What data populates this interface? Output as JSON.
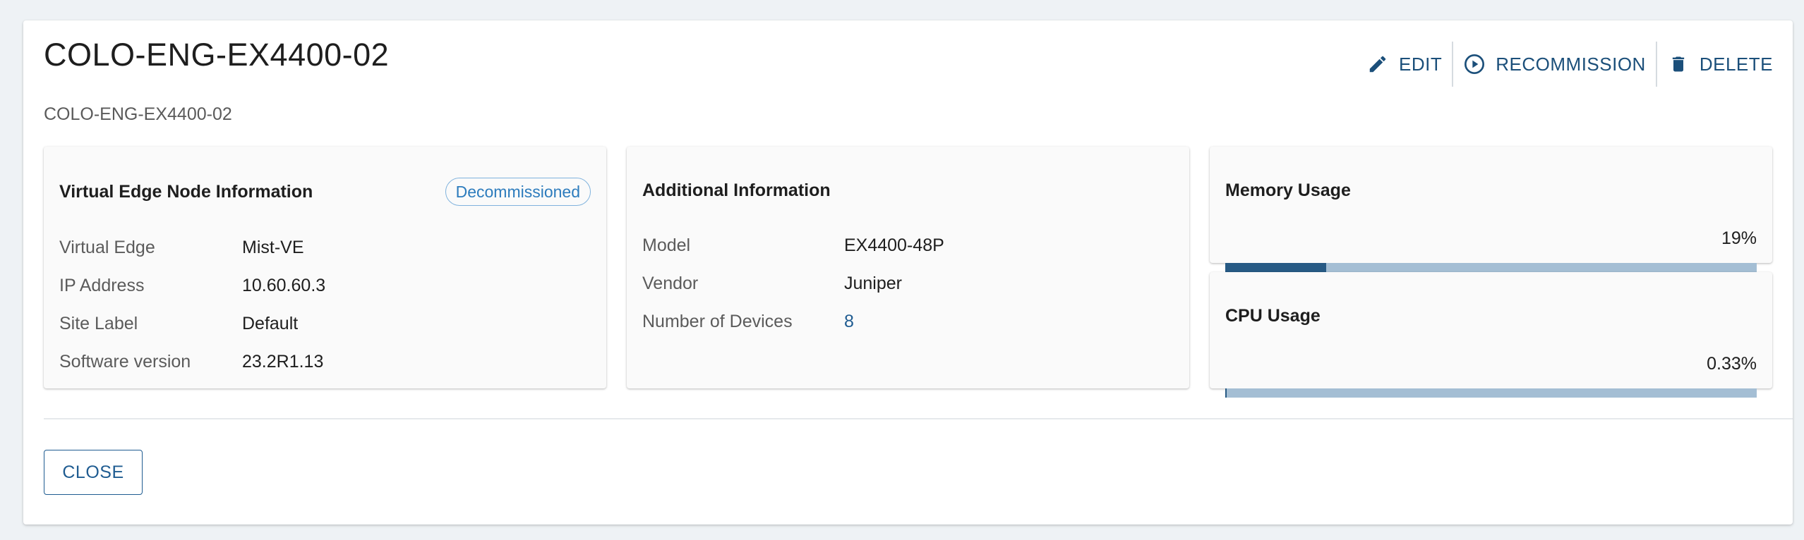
{
  "dialog": {
    "title": "COLO-ENG-EX4400-02",
    "subtitle": "COLO-ENG-EX4400-02",
    "actions": {
      "edit": {
        "label": "EDIT",
        "icon": "pencil-icon"
      },
      "recommission": {
        "label": "RECOMMISSION",
        "icon": "play-circle-icon"
      },
      "delete": {
        "label": "DELETE",
        "icon": "trash-icon"
      }
    },
    "close_label": "CLOSE"
  },
  "node_info": {
    "title": "Virtual Edge Node Information",
    "status": "Decommissioned",
    "rows": [
      {
        "label": "Virtual Edge",
        "value": "Mist-VE"
      },
      {
        "label": "IP Address",
        "value": "10.60.60.3"
      },
      {
        "label": "Site Label",
        "value": "Default"
      },
      {
        "label": "Software version",
        "value": "23.2R1.13"
      }
    ]
  },
  "additional_info": {
    "title": "Additional Information",
    "rows": [
      {
        "label": "Model",
        "value": "EX4400-48P"
      },
      {
        "label": "Vendor",
        "value": "Juniper"
      },
      {
        "label": "Number of Devices",
        "value": "8"
      }
    ]
  },
  "memory_usage": {
    "title": "Memory Usage",
    "percent_label": "19%",
    "fraction": 0.19
  },
  "cpu_usage": {
    "title": "CPU Usage",
    "percent_label": "0.33%",
    "fraction": 0.0033
  },
  "colors": {
    "accent": "#1f5c91",
    "bar_fill": "#275a84",
    "bar_track": "#a4bed4",
    "badge": "#2d7cbd",
    "background": "#eef2f5"
  }
}
